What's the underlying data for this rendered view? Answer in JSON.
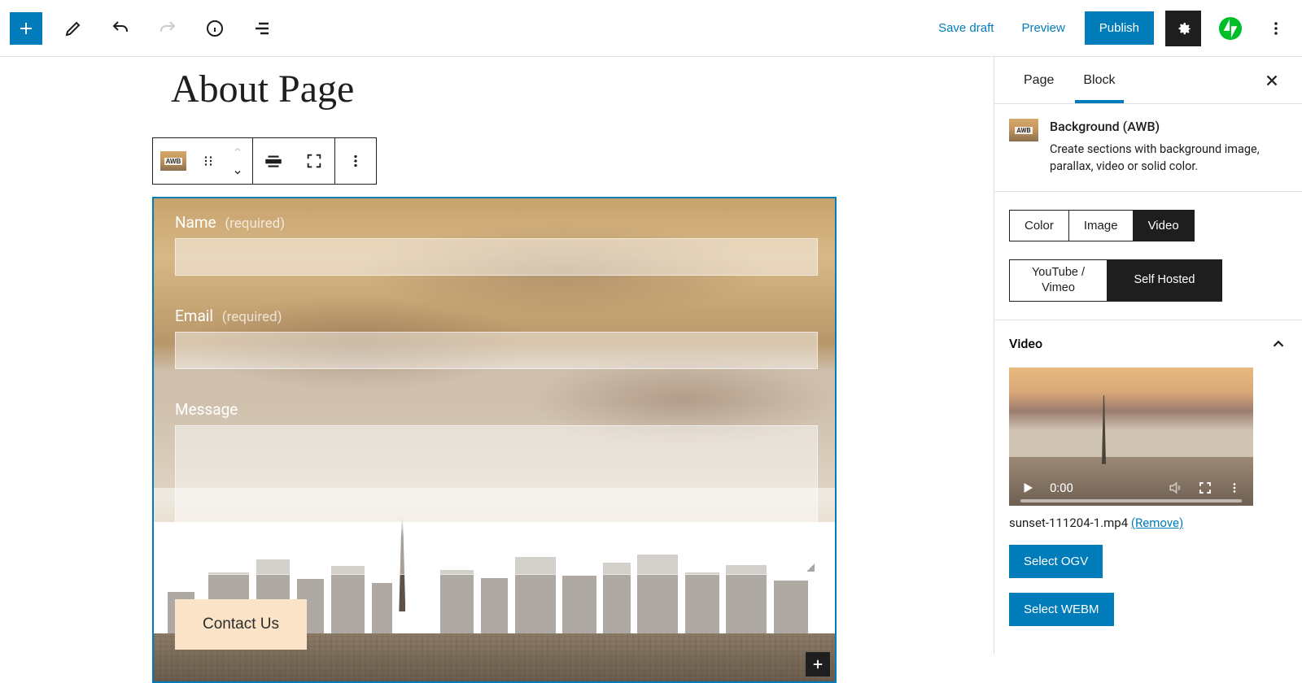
{
  "toolbar": {
    "save_draft": "Save draft",
    "preview": "Preview",
    "publish": "Publish"
  },
  "page_title": "About Page",
  "form": {
    "name_label": "Name",
    "email_label": "Email",
    "message_label": "Message",
    "required": "(required)",
    "submit_label": "Contact Us"
  },
  "sidebar": {
    "tabs": {
      "page": "Page",
      "block": "Block"
    },
    "block": {
      "title": "Background (AWB)",
      "description": "Create sections with background image, parallax, video or solid color."
    },
    "type_tabs": {
      "color": "Color",
      "image": "Image",
      "video": "Video"
    },
    "source_tabs": {
      "youtube": "YouTube / Vimeo",
      "self": "Self Hosted"
    },
    "video_panel": {
      "title": "Video",
      "time": "0:00",
      "filename": "sunset-111204-1.mp4",
      "remove": "(Remove)",
      "select_ogv": "Select OGV",
      "select_webm": "Select WEBM"
    }
  }
}
